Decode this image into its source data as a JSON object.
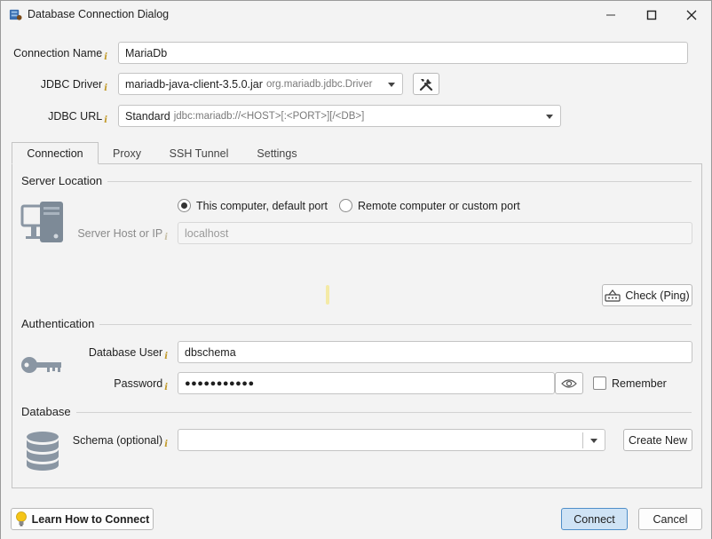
{
  "window": {
    "title": "Database Connection Dialog"
  },
  "header": {
    "connection_name_label": "Connection Name",
    "connection_name_value": "MariaDb",
    "jdbc_driver_label": "JDBC Driver",
    "jdbc_driver_jar": "mariadb-java-client-3.5.0.jar",
    "jdbc_driver_class": "org.mariadb.jdbc.Driver",
    "jdbc_url_label": "JDBC URL",
    "jdbc_url_mode": "Standard",
    "jdbc_url_template": "jdbc:mariadb://<HOST>[:<PORT>][/<DB>]",
    "info_glyph": "i"
  },
  "tabs": [
    {
      "label": "Connection",
      "active": true
    },
    {
      "label": "Proxy",
      "active": false
    },
    {
      "label": "SSH Tunnel",
      "active": false
    },
    {
      "label": "Settings",
      "active": false
    }
  ],
  "server_location": {
    "title": "Server Location",
    "radio_local": "This computer, default port",
    "radio_remote": "Remote computer or custom port",
    "selected": "local",
    "host_label": "Server Host or IP",
    "host_value": "localhost",
    "check_ping": "Check (Ping)"
  },
  "authentication": {
    "title": "Authentication",
    "user_label": "Database User",
    "user_value": "dbschema",
    "password_label": "Password",
    "password_value": "●●●●●●●●●●●",
    "remember_label": "Remember",
    "remember_checked": false
  },
  "database": {
    "title": "Database",
    "schema_label": "Schema (optional)",
    "schema_value": "",
    "create_new": "Create New"
  },
  "footer": {
    "learn_label": "Learn How to Connect",
    "connect_label": "Connect",
    "cancel_label": "Cancel"
  },
  "colors": {
    "info_icon": "#c29a2a",
    "primary_button": "#cfe3f5",
    "primary_border": "#4f8fc9",
    "dialog_bg": "#f3f3f3"
  }
}
